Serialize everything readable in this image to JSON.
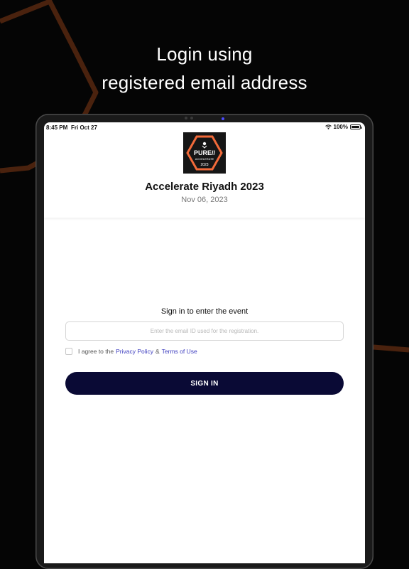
{
  "promo": {
    "headline_line1": "Login using",
    "headline_line2": "registered email address"
  },
  "statusbar": {
    "time": "8:45 PM",
    "date": "Fri Oct 27",
    "battery": "100%"
  },
  "event": {
    "logo_text_top": "PURE//",
    "logo_text_mid": "ACCELERATE",
    "logo_text_year": "2023",
    "title": "Accelerate Riyadh 2023",
    "date": "Nov 06, 2023"
  },
  "signin": {
    "heading": "Sign in to enter the event",
    "email_placeholder": "Enter the email ID used for the registration.",
    "agree_prefix": "I agree to the",
    "privacy_link": "Privacy Policy",
    "ampersand": "&",
    "terms_link": "Terms of Use",
    "button_label": "SIGN IN"
  },
  "colors": {
    "background": "#050505",
    "accent_line": "#5a2a12",
    "button": "#0a0a35",
    "link": "#3d3dbf",
    "logo_orange": "#f26a3a"
  }
}
